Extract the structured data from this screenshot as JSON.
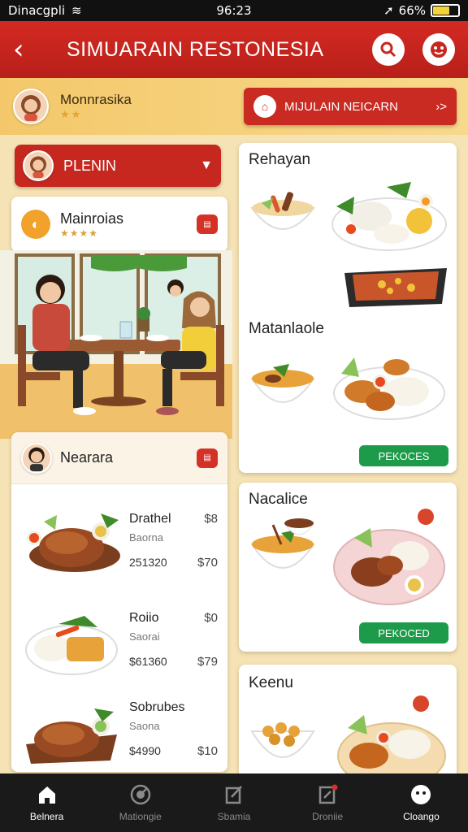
{
  "status_bar": {
    "carrier": "Dinacgpli",
    "time": "96:23",
    "battery": "66%",
    "battery_level": 0.66
  },
  "app_bar": {
    "title": "SIMUARAIN RESTONESIA"
  },
  "user": {
    "name": "Monnrasika",
    "stars": "★★"
  },
  "cta": {
    "label": "MIJULAIN NEICARN",
    "arrow": "›>"
  },
  "plan": {
    "label": "PLENIN"
  },
  "restaurant": {
    "title": "Mainroias",
    "rating": "★★★★"
  },
  "menu": {
    "title": "Nearara",
    "items": [
      {
        "name": "Drathel",
        "sub": "Baorna",
        "number": "251320",
        "price1": "$8",
        "price2": "$70"
      },
      {
        "name": "Roiio",
        "sub": "Saorai",
        "number": "$61360",
        "price1": "$0",
        "price2": "$79"
      },
      {
        "name": "Sobrubes",
        "sub": "Saona",
        "number": "$4990",
        "price2": "$10"
      }
    ]
  },
  "cards": [
    {
      "title": "Rehayan"
    },
    {
      "title": "Matanlaole",
      "button": "PEKOCES"
    },
    {
      "title": "Nacalice",
      "button": "PEKOCED"
    },
    {
      "title": "Keenu"
    }
  ],
  "nav": [
    {
      "label": "Belnera",
      "icon": "home-icon"
    },
    {
      "label": "Mationgie",
      "icon": "dial-icon"
    },
    {
      "label": "Sbamia",
      "icon": "edit-icon"
    },
    {
      "label": "Droniie",
      "icon": "doc-icon"
    },
    {
      "label": "Cloango",
      "icon": "face-icon"
    }
  ]
}
